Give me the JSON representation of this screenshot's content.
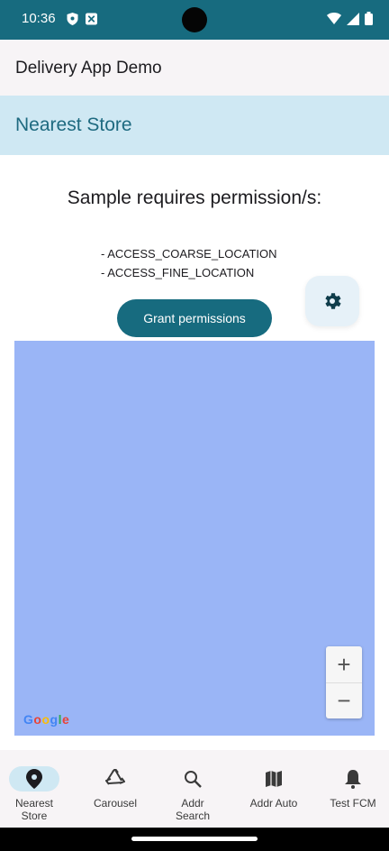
{
  "status_bar": {
    "time": "10:36",
    "icons": [
      "shield-icon",
      "notification-icon",
      "wifi-icon",
      "signal-icon",
      "battery-icon"
    ]
  },
  "app_bar": {
    "title": "Delivery App Demo"
  },
  "section": {
    "title": "Nearest Store"
  },
  "permissions": {
    "heading": "Sample requires permission/s:",
    "items": [
      "- ACCESS_COARSE_LOCATION",
      "- ACCESS_FINE_LOCATION"
    ],
    "grant_label": "Grant permissions"
  },
  "map": {
    "logo": "Google",
    "zoom_in": "+",
    "zoom_out": "−"
  },
  "bottom_nav": {
    "items": [
      {
        "label": "Nearest Store",
        "icon": "location-pin-icon",
        "active": true
      },
      {
        "label": "Carousel",
        "icon": "recycle-icon",
        "active": false
      },
      {
        "label": "Addr Search",
        "icon": "search-icon",
        "active": false
      },
      {
        "label": "Addr Auto",
        "icon": "map-icon",
        "active": false
      },
      {
        "label": "Test FCM",
        "icon": "bell-icon",
        "active": false
      }
    ]
  },
  "colors": {
    "primary": "#176b7f",
    "section_bg": "#cfe8f3",
    "map_bg": "#9ab5f6"
  }
}
